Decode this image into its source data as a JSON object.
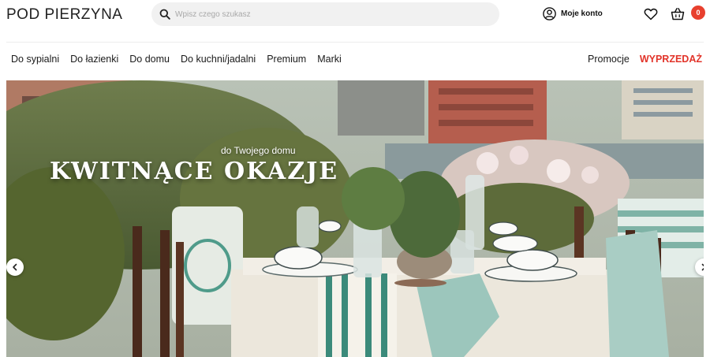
{
  "header": {
    "logo": "POD PIERZYNA",
    "search_placeholder": "Wpisz czego szukasz",
    "account_label": "Moje konto",
    "cart_count": "0"
  },
  "nav": {
    "left": [
      "Do sypialni",
      "Do łazienki",
      "Do domu",
      "Do kuchni/jadalni",
      "Premium",
      "Marki"
    ],
    "promo": "Promocje",
    "sale": "WYPRZEDAŻ"
  },
  "hero": {
    "subtitle": "do Twojego domu",
    "title": "KWITNĄCE OKAZJE"
  },
  "colors": {
    "accent": "#e8402e",
    "sale": "#e2342a"
  },
  "icons": [
    "search-icon",
    "user-icon",
    "heart-icon",
    "basket-icon",
    "chevron-left-icon",
    "chevron-right-icon"
  ]
}
